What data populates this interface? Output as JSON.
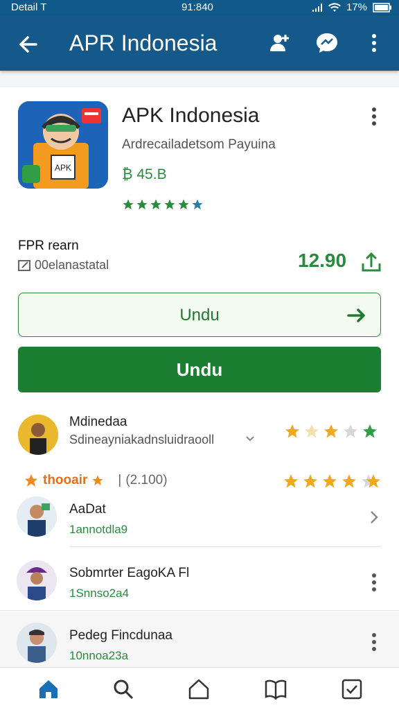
{
  "status_bar": {
    "left": "Detail T",
    "time": "91:840",
    "battery": "17%"
  },
  "app_bar": {
    "title": "APR Indonesia",
    "icons": [
      "back-arrow-icon",
      "user-plus-icon",
      "chat-icon",
      "more-vert-icon"
    ]
  },
  "app": {
    "name": "APK Indonesia",
    "developer": "Ardrecailadetsom Payuina",
    "size": "₿ 45.B",
    "rating_stars": 6,
    "icon_text": "APK"
  },
  "section": {
    "title": "FPR rearn",
    "subtitle": "00elanastatal",
    "price": "12.90"
  },
  "buttons": {
    "outline_label": "Undu",
    "primary_label": "Undu"
  },
  "top_review": {
    "name": "Mdinedaa",
    "subtitle": "Sdineayniakadnsluidraooll",
    "stars": 4,
    "max_stars": 5
  },
  "ratings_summary": {
    "label": "thooair",
    "count": "(2.100)",
    "stars": 4,
    "max_stars": 5
  },
  "reviewers": [
    {
      "name": "AaDat",
      "meta": "1annotdla9",
      "action": "chevron-right-icon"
    },
    {
      "name": "Sobmrter EagoKA Fl",
      "meta": "1Snnso2a4",
      "action": "more-vert-icon"
    },
    {
      "name": "Pedeg Fincdunaa",
      "meta": "10nnoa23a",
      "action": "more-vert-icon"
    }
  ],
  "bottom_nav": [
    "home-icon",
    "search-icon",
    "house-outline-icon",
    "book-icon",
    "checkbox-icon"
  ],
  "colors": {
    "primary": "#15598a",
    "accent_green": "#1c7e31",
    "star_gold": "#f0a81c"
  }
}
